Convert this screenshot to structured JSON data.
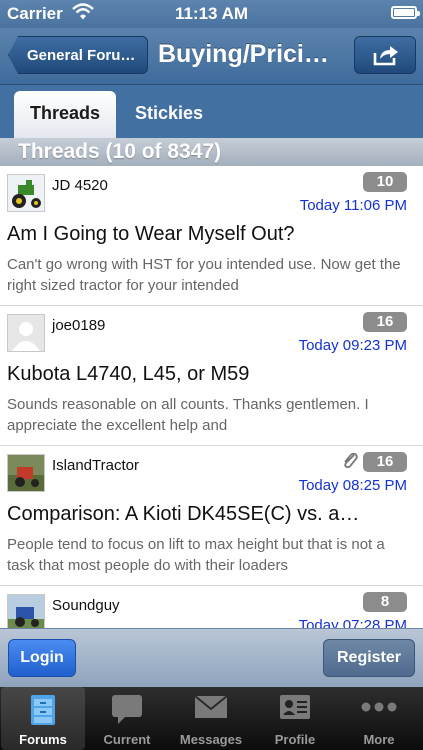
{
  "status": {
    "carrier": "Carrier",
    "time": "11:13 AM"
  },
  "nav": {
    "back_label": "General Foru…",
    "title": "Buying/Prici…"
  },
  "tabs": [
    {
      "label": "Threads"
    },
    {
      "label": "Stickies"
    }
  ],
  "section": {
    "title": "Threads (10 of 8347)"
  },
  "threads": [
    {
      "author": "JD 4520",
      "count": "10",
      "date": "Today 11:06 PM",
      "title": "Am I Going to Wear Myself Out?",
      "snippet": "Can't go wrong with HST for you intended use. Now get the right sized tractor for your intended"
    },
    {
      "author": "joe0189",
      "count": "16",
      "date": "Today 09:23 PM",
      "title": "Kubota L4740, L45, or M59",
      "snippet": "Sounds reasonable on all counts.  Thanks gentlemen.  I appreciate the excellent help and"
    },
    {
      "author": "IslandTractor",
      "count": "16",
      "date": "Today 08:25 PM",
      "title": "Comparison: A Kioti DK45SE(C) vs.   a…",
      "snippet": "People tend to focus on lift to max height but that is not a task that most people do with their loaders"
    },
    {
      "author": "Soundguy",
      "count": "8",
      "date": "Today 07:28 PM",
      "title": "",
      "snippet": ""
    }
  ],
  "auth": {
    "login_label": "Login",
    "register_label": "Register"
  },
  "tabbar": [
    {
      "label": "Forums",
      "icon": "cabinet-icon"
    },
    {
      "label": "Current",
      "icon": "speech-bubble-icon"
    },
    {
      "label": "Messages",
      "icon": "envelope-icon"
    },
    {
      "label": "Profile",
      "icon": "id-card-icon"
    },
    {
      "label": "More",
      "icon": "more-dots-icon"
    }
  ],
  "colors": {
    "accent": "#4270a1",
    "date": "#1432d4",
    "login": "#2b6fe0"
  }
}
